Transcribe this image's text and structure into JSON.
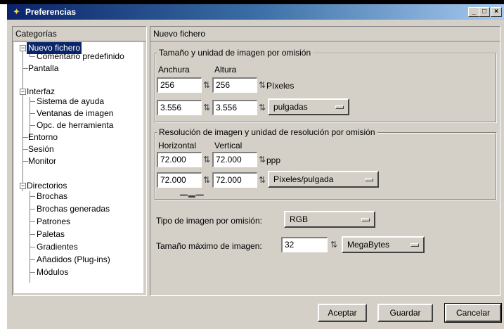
{
  "window": {
    "title": "Preferencias",
    "controls": [
      "_",
      "□",
      "×"
    ]
  },
  "sidebar": {
    "header": "Categorías",
    "items": [
      {
        "label": "Nuevo fichero",
        "selected": true
      },
      {
        "label": "Comentario predefinido"
      },
      {
        "label": "Pantalla"
      },
      {
        "label": "Interfaz"
      },
      {
        "label": "Sistema de ayuda"
      },
      {
        "label": "Ventanas de imagen"
      },
      {
        "label": "Opc. de herramienta"
      },
      {
        "label": "Entorno"
      },
      {
        "label": "Sesión"
      },
      {
        "label": "Monitor"
      },
      {
        "label": "Directorios"
      },
      {
        "label": "Brochas"
      },
      {
        "label": "Brochas generadas"
      },
      {
        "label": "Patrones"
      },
      {
        "label": "Paletas"
      },
      {
        "label": "Gradientes"
      },
      {
        "label": "Añadidos (Plug-ins)"
      },
      {
        "label": "Módulos"
      }
    ]
  },
  "main": {
    "header": "Nuevo fichero",
    "size_group": {
      "title": "Tamaño y unidad de imagen por omisión",
      "width_label": "Anchura",
      "height_label": "Altura",
      "width_px": "256",
      "height_px": "256",
      "px_unit": "Píxeles",
      "width_in": "3.556",
      "height_in": "3.556",
      "unit_menu": "pulgadas"
    },
    "res_group": {
      "title": "Resolución de imagen y unidad de resolución por omisión",
      "h_label": "Horizontal",
      "v_label": "Vertical",
      "h_ppp": "72.000",
      "v_ppp": "72.000",
      "ppp_unit": "ppp",
      "h_unit": "72.000",
      "v_unit": "72.000",
      "unit_menu": "Píxeles/pulgada"
    },
    "image_type": {
      "label": "Tipo de imagen por omisión:",
      "value": "RGB"
    },
    "max_size": {
      "label": "Tamaño máximo de imagen:",
      "value": "32",
      "unit": "MegaBytes"
    }
  },
  "buttons": {
    "ok": "Aceptar",
    "save": "Guardar",
    "cancel": "Cancelar"
  },
  "icons": {
    "tree_expanded": "minus-box-icon",
    "spin": "spin-arrows-icon",
    "menu_indicator": "option-menu-indicator",
    "chain": "chain-link-icon"
  }
}
